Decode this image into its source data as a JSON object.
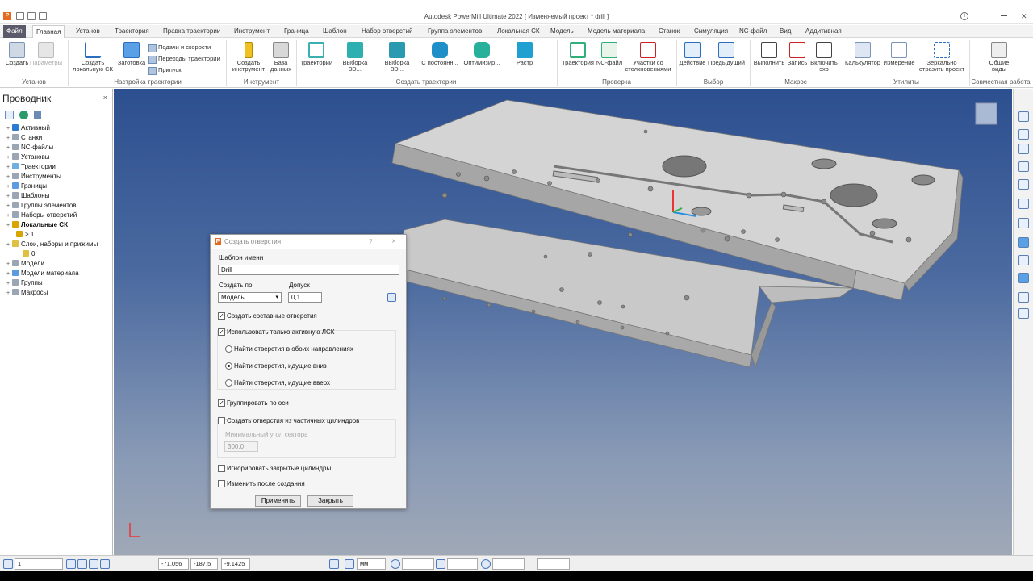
{
  "window": {
    "title": "Autodesk PowerMill Ultimate 2022    [ Изменяемый проект * drill ]"
  },
  "menu": [
    "Файл",
    "Главная",
    "Установ",
    "Траектория",
    "Правка траектории",
    "Инструмент",
    "Граница",
    "Шаблон",
    "Набор отверстий",
    "Группа элементов",
    "Локальная СК",
    "Модель",
    "Модель материала",
    "Станок",
    "Симуляция",
    "NC-файл",
    "Вид",
    "Аддитивная"
  ],
  "ribbon": {
    "create": "Создать",
    "params": "Параметры",
    "create_lcs": "Создать локальную СК",
    "billet": "Заготовка",
    "feeds": "Подачи и скорости",
    "transitions": "Переходы траектории",
    "allowance": "Припуск",
    "create_tool": "Создать инструмент",
    "database": "База данных",
    "toolpaths": "Траектории",
    "sel3d_1": "Выборка 3D...",
    "sel3d_2": "Выборка 3D...",
    "constant": "С постоянн...",
    "optim": "Оптимизир...",
    "raster": "Растр",
    "traj": "Траектория",
    "ncfile": "NC-файл",
    "collisions": "Участки со столкновениями",
    "action": "Действие",
    "previous": "Предыдущий",
    "run": "Выполнить",
    "record": "Запись",
    "echo": "Включить эхо",
    "calc": "Калькулятор",
    "measure": "Измерение",
    "mirror": "Зеркально отразить проект",
    "shared_views": "Общие виды",
    "groups": [
      "Установ",
      "Настройка траектории",
      "Инструмент",
      "Создать траектории",
      "Проверка",
      "Выбор",
      "Макрос",
      "Утилиты",
      "Совместная работа"
    ]
  },
  "explorer": {
    "title": "Проводник",
    "close": "×",
    "items": [
      {
        "label": "Активный",
        "color": "#2a7bd4"
      },
      {
        "label": "Станки",
        "color": "#9aa6b4"
      },
      {
        "label": "NC-файлы",
        "color": "#9aa6b4"
      },
      {
        "label": "Установы",
        "color": "#9aa6b4"
      },
      {
        "label": "Траектории",
        "color": "#6fb0e0"
      },
      {
        "label": "Инструменты",
        "color": "#9aa6b4"
      },
      {
        "label": "Границы",
        "color": "#5b9be0"
      },
      {
        "label": "Шаблоны",
        "color": "#9aa6b4"
      },
      {
        "label": "Группы элементов",
        "color": "#9aa6b4"
      },
      {
        "label": "Наборы отверстий",
        "color": "#9aa6b4"
      },
      {
        "label": "Локальные СК",
        "color": "#d9a400"
      },
      {
        "label": "> 1",
        "color": "#d9a400"
      },
      {
        "label": "Слои, наборы и прижимы",
        "color": "#e0c040"
      },
      {
        "label": "0",
        "color": "#e0c040"
      },
      {
        "label": "Модели",
        "color": "#9aa6b4"
      },
      {
        "label": "Модели материала",
        "color": "#5b9be0"
      },
      {
        "label": "Группы",
        "color": "#9aa6b4"
      },
      {
        "label": "Макросы",
        "color": "#9aa6b4"
      }
    ]
  },
  "dialog": {
    "title": "Создать отверстия",
    "help": "?",
    "close": "×",
    "name_label": "Шаблон имени",
    "name_value": "Drill",
    "create_by_label": "Создать по",
    "create_by_value": "Модель",
    "tolerance_label": "Допуск",
    "tolerance_value": "0,1",
    "compound": "Создать составные отверстия",
    "active_lcs": "Использовать только активную ЛСК",
    "both_dirs": "Найти отверстия в обоих направлениях",
    "down": "Найти отверстия, идущие вниз",
    "up": "Найти отверстия, идущие вверх",
    "group_axis": "Группировать по оси",
    "partial_cyl": "Создать отверстия из частичных цилиндров",
    "min_angle_label": "Минимальный угол сектора",
    "min_angle_value": "300,0",
    "ignore_closed": "Игнорировать закрытые цилиндры",
    "edit_after": "Изменить после создания",
    "apply": "Применить",
    "close_btn": "Закрыть"
  },
  "status": {
    "layer": "1",
    "x": "-71,056",
    "y": "-187,5",
    "z": "-9,1425",
    "units": "мм"
  },
  "colors": {
    "accent": "#2a6ebd",
    "brand_orange": "#e26b1f",
    "viewport_top": "#2c4f8f",
    "viewport_bottom": "#9fa8b6"
  }
}
